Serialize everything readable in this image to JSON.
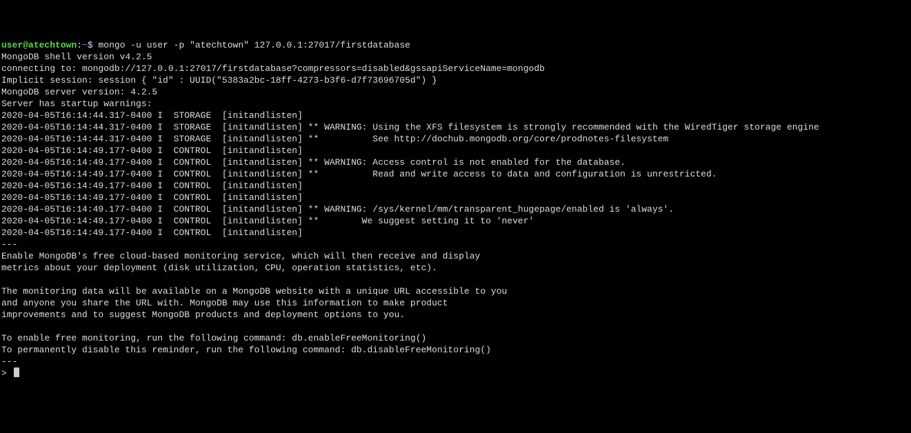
{
  "prompt": {
    "user": "user",
    "at": "@",
    "host": "atechtown",
    "colon": ":",
    "tilde": "~",
    "dollar": "$",
    "command": "mongo -u user -p \"atechtown\" 127.0.0.1:27017/firstdatabase"
  },
  "lines": [
    "MongoDB shell version v4.2.5",
    "connecting to: mongodb://127.0.0.1:27017/firstdatabase?compressors=disabled&gssapiServiceName=mongodb",
    "Implicit session: session { \"id\" : UUID(\"5383a2bc-18ff-4273-b3f6-d7f73696705d\") }",
    "MongoDB server version: 4.2.5",
    "Server has startup warnings:",
    "2020-04-05T16:14:44.317-0400 I  STORAGE  [initandlisten]",
    "2020-04-05T16:14:44.317-0400 I  STORAGE  [initandlisten] ** WARNING: Using the XFS filesystem is strongly recommended with the WiredTiger storage engine",
    "2020-04-05T16:14:44.317-0400 I  STORAGE  [initandlisten] **          See http://dochub.mongodb.org/core/prodnotes-filesystem",
    "2020-04-05T16:14:49.177-0400 I  CONTROL  [initandlisten]",
    "2020-04-05T16:14:49.177-0400 I  CONTROL  [initandlisten] ** WARNING: Access control is not enabled for the database.",
    "2020-04-05T16:14:49.177-0400 I  CONTROL  [initandlisten] **          Read and write access to data and configuration is unrestricted.",
    "2020-04-05T16:14:49.177-0400 I  CONTROL  [initandlisten]",
    "2020-04-05T16:14:49.177-0400 I  CONTROL  [initandlisten]",
    "2020-04-05T16:14:49.177-0400 I  CONTROL  [initandlisten] ** WARNING: /sys/kernel/mm/transparent_hugepage/enabled is 'always'.",
    "2020-04-05T16:14:49.177-0400 I  CONTROL  [initandlisten] **        We suggest setting it to 'never'",
    "2020-04-05T16:14:49.177-0400 I  CONTROL  [initandlisten]",
    "---",
    "Enable MongoDB's free cloud-based monitoring service, which will then receive and display",
    "metrics about your deployment (disk utilization, CPU, operation statistics, etc).",
    "",
    "The monitoring data will be available on a MongoDB website with a unique URL accessible to you",
    "and anyone you share the URL with. MongoDB may use this information to make product",
    "improvements and to suggest MongoDB products and deployment options to you.",
    "",
    "To enable free monitoring, run the following command: db.enableFreeMonitoring()",
    "To permanently disable this reminder, run the following command: db.disableFreeMonitoring()",
    "---"
  ],
  "shell_prompt": ">"
}
